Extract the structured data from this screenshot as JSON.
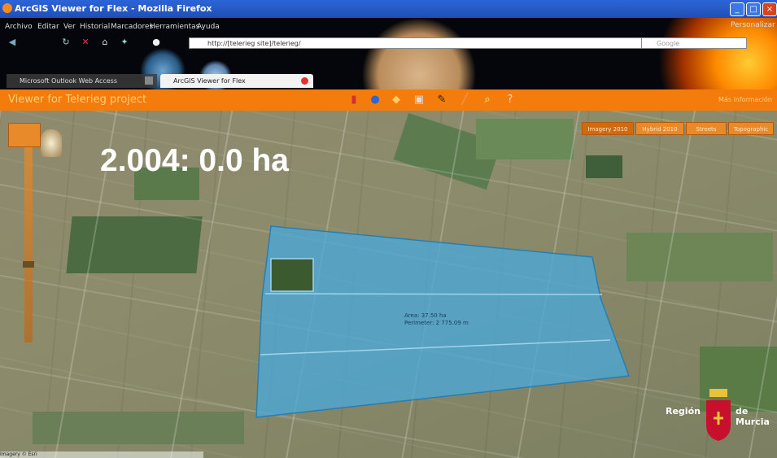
{
  "browser": {
    "window_title": "ArcGIS Viewer for Flex - Mozilla Firefox",
    "menu": [
      "Archivo",
      "Editar",
      "Ver",
      "Historial",
      "Marcadores",
      "Herramientas",
      "Ayuda"
    ],
    "url": "http://[telerieg site]/telerieg/",
    "search_placeholder": "Google",
    "tabs": [
      {
        "label": "Microsoft Outlook Web Access"
      },
      {
        "label": "ArcGIS Viewer for Flex"
      }
    ],
    "top_right_text": "Personalizar"
  },
  "app": {
    "title": "Viewer for Telerieg project",
    "right_link": "Más información",
    "toolbar_icons": [
      "bookmark-icon",
      "globe-icon",
      "layers-icon",
      "print-icon",
      "draw-icon",
      "measure-icon",
      "search-icon",
      "help-icon"
    ],
    "map_buttons": [
      "Imagery 2010",
      "Hybrid 2010",
      "Streets",
      "Topographic"
    ]
  },
  "map": {
    "overlay_label": "2.004: 0.0 ha",
    "polygon_area": "Area: 37.50 ha",
    "polygon_perimeter": "Perimeter: 2 775.09 m",
    "region_logo_left": "Región",
    "region_logo_right": "de Murcia",
    "scale_label": "Imagery © Esri"
  },
  "colors": {
    "titlebar": "#1f4fb5",
    "app_bar": "#f47c0c",
    "polygon_fill": "#4aa8d8",
    "label_text": "#ffffff"
  }
}
